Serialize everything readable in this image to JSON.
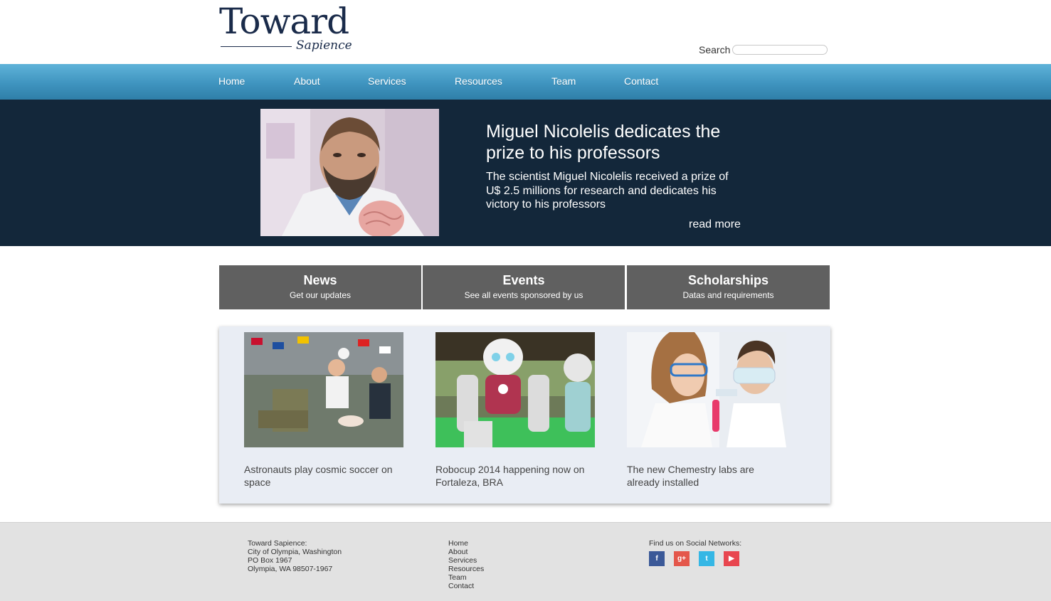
{
  "header": {
    "logo_main": "Toward",
    "logo_sub": "Sapience",
    "search_label": "Search",
    "search_placeholder": ""
  },
  "nav": {
    "items": [
      {
        "label": "Home"
      },
      {
        "label": "About"
      },
      {
        "label": "Services"
      },
      {
        "label": "Resources"
      },
      {
        "label": "Team"
      },
      {
        "label": "Contact"
      }
    ]
  },
  "hero": {
    "title": "Miguel Nicolelis dedicates the prize to his professors",
    "text": "The scientist Miguel Nicolelis received a prize of U$ 2.5 millions for research and dedicates his victory to his professors",
    "read_more": "read more"
  },
  "boxes": [
    {
      "title": "News",
      "subtitle": "Get our updates"
    },
    {
      "title": "Events",
      "subtitle": "See all events sponsored by us"
    },
    {
      "title": "Scholarships",
      "subtitle": "Datas and requirements"
    }
  ],
  "articles": [
    {
      "caption": "Astronauts play cosmic soccer on space"
    },
    {
      "caption": "Robocup 2014 happening now on Fortaleza, BRA"
    },
    {
      "caption": "The new Chemestry labs are already installed"
    }
  ],
  "footer": {
    "address": [
      "Toward Sapience:",
      "City of Olympia, Washington",
      "PO Box 1967",
      "Olympia, WA 98507-1967"
    ],
    "links": [
      "Home",
      "About",
      "Services",
      "Resources",
      "Team",
      "Contact"
    ],
    "social_title": "Find us on Social Networks:",
    "social": [
      {
        "icon": "facebook-icon",
        "glyph": "f",
        "color": "#3b5998"
      },
      {
        "icon": "google-plus-icon",
        "glyph": "g+",
        "color": "#e4574b"
      },
      {
        "icon": "twitter-icon",
        "glyph": "t",
        "color": "#35b7e5"
      },
      {
        "icon": "youtube-icon",
        "glyph": "▶",
        "color": "#e8464f"
      }
    ]
  },
  "colors": {
    "nav_blue": "#3f94bf",
    "hero_bg": "#13273a",
    "box_gray": "#606060",
    "panel_bg": "#e9edf4",
    "footer_bg": "#e2e2e2"
  }
}
